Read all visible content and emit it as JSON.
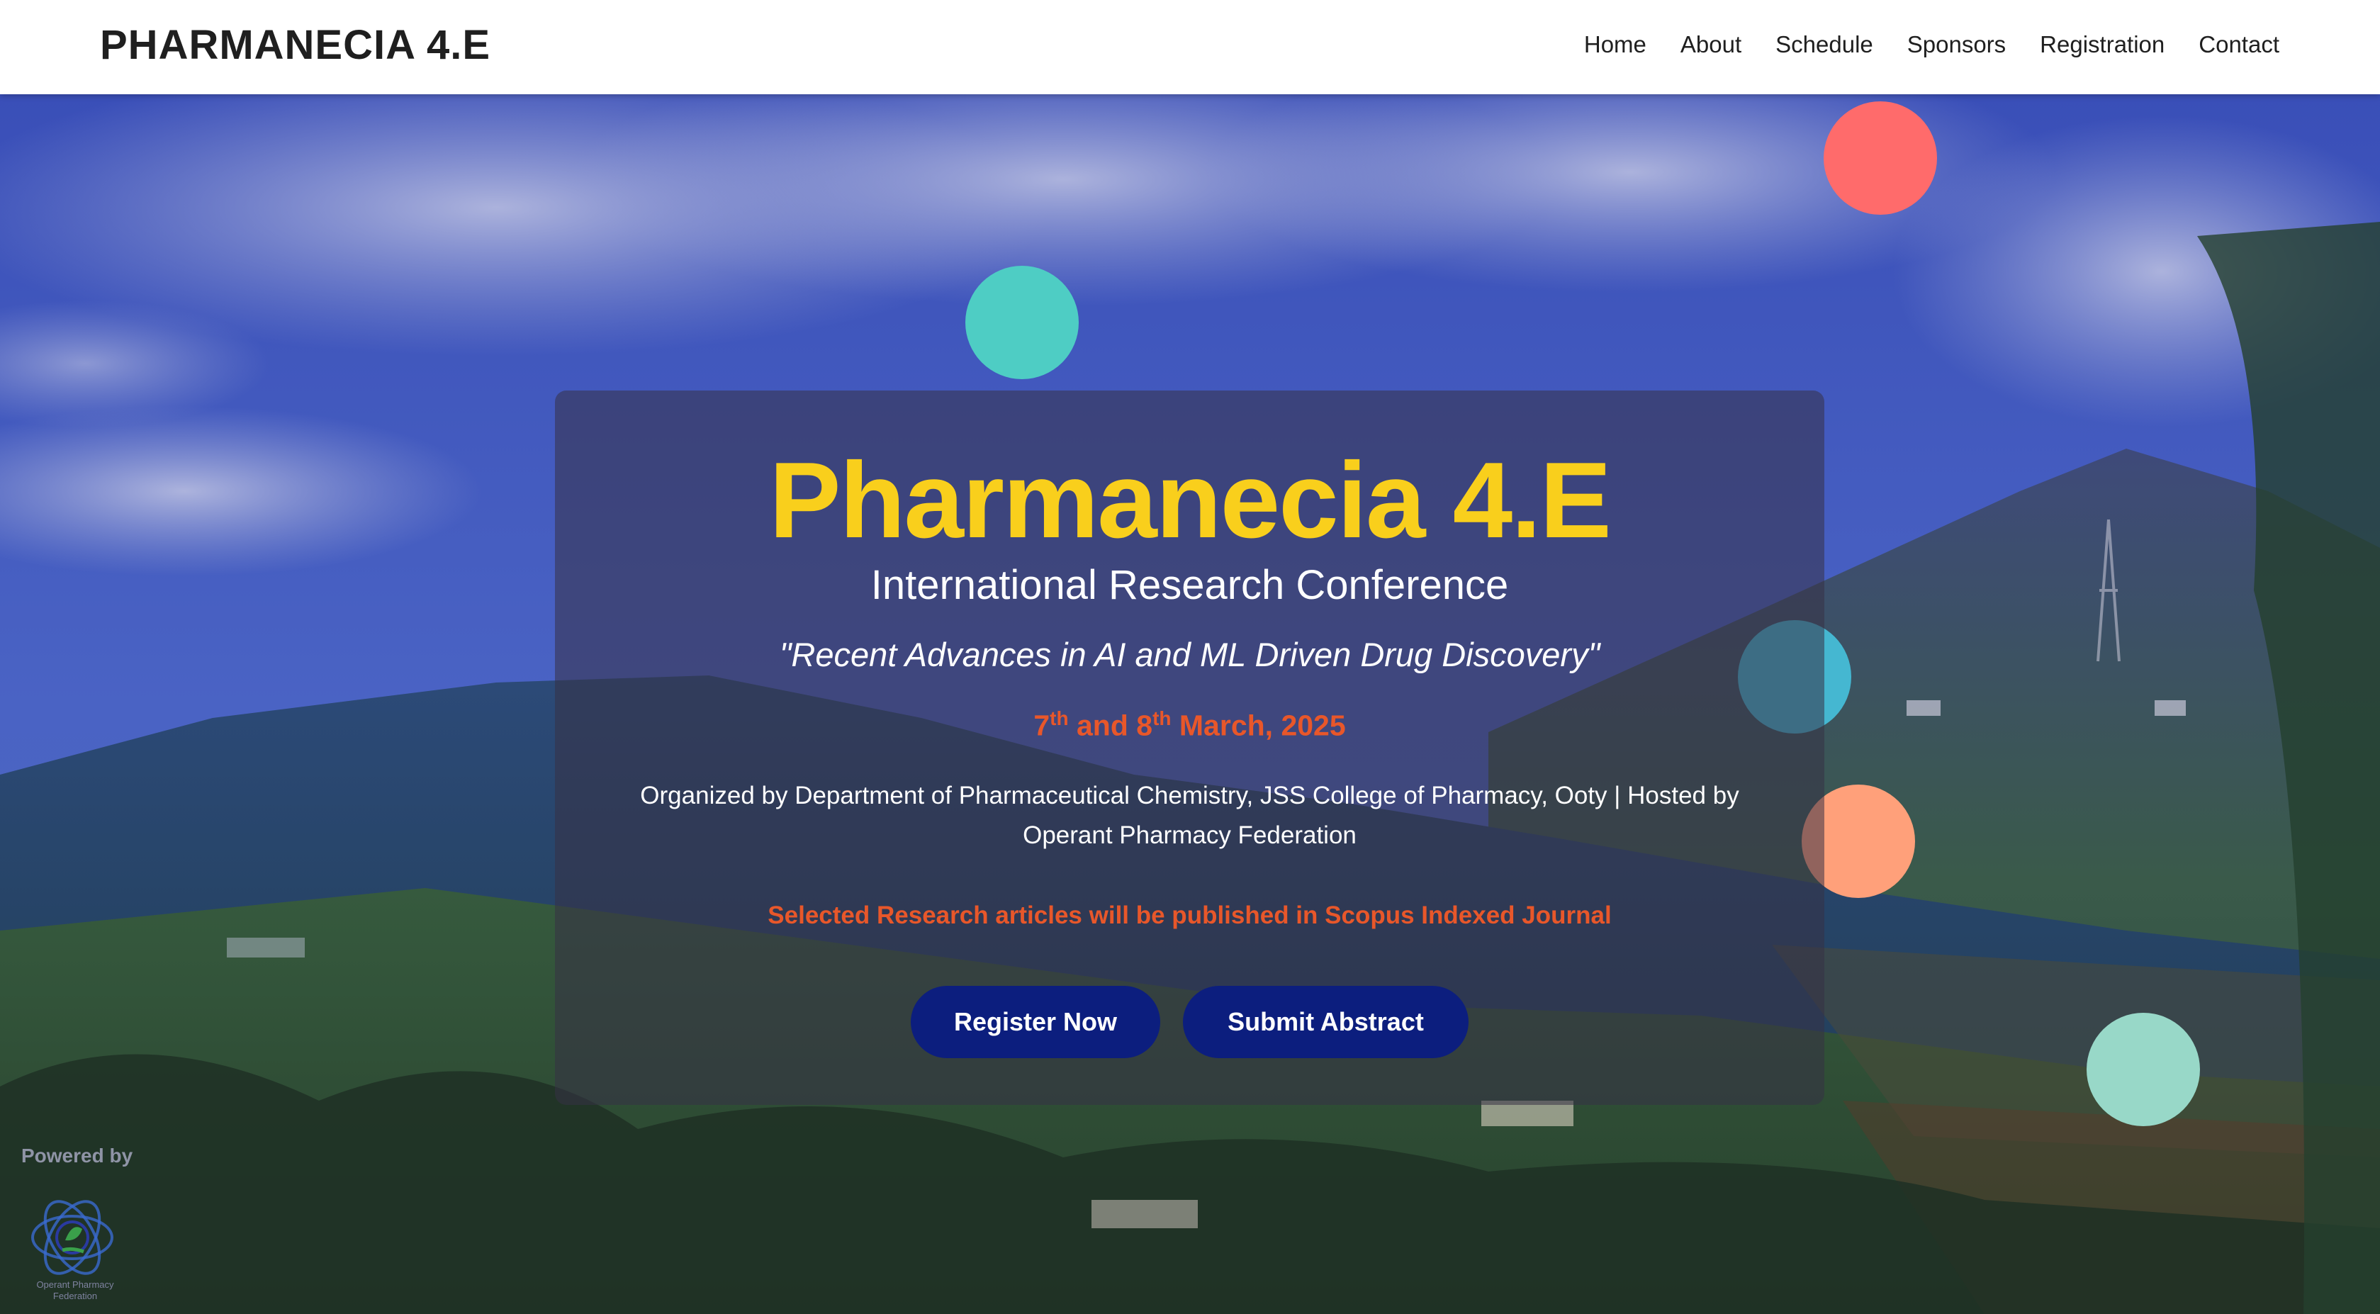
{
  "navbar": {
    "brand": "PHARMANECIA 4.E",
    "links": [
      "Home",
      "About",
      "Schedule",
      "Sponsors",
      "Registration",
      "Contact"
    ]
  },
  "hero": {
    "title": "Pharmanecia 4.E",
    "subtitle": "International Research Conference",
    "theme": "\"Recent Advances in AI and ML Driven Drug Discovery\"",
    "date": {
      "day1": "7",
      "day1_suffix": "th",
      "connector": " and ",
      "day2": "8",
      "day2_suffix": "th",
      "rest": " March, 2025"
    },
    "organized_by": "Organized by Department of Pharmaceutical Chemistry, JSS College of Pharmacy, Ooty | Hosted by Operant Pharmacy Federation",
    "scopus_note": "Selected Research articles will be published in Scopus Indexed Journal",
    "register_button": "Register Now",
    "abstract_button": "Submit Abstract"
  },
  "footer_badge": {
    "powered_by": "Powered by",
    "logo_text": "Operant Pharmacy Federation"
  },
  "colors": {
    "title": "#f9cf1c",
    "accent_orange": "#e8572a",
    "button_bg": "#0c1e7e",
    "overlay_blue": "#2a3a9a"
  }
}
